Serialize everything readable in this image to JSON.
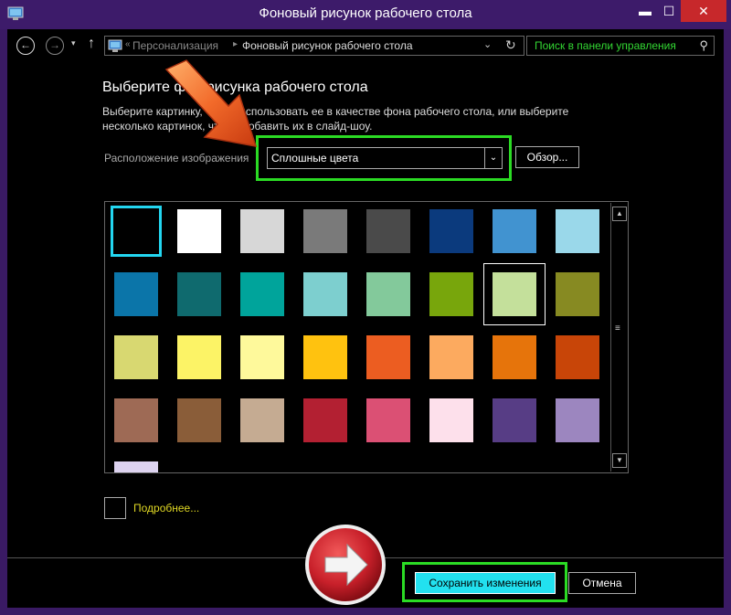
{
  "window": {
    "title": "Фоновый рисунок рабочего стола",
    "min_glyph": "▬",
    "max_glyph": "☐",
    "close_glyph": "✕"
  },
  "nav": {
    "back_glyph": "←",
    "forward_glyph": "→",
    "history_glyph": "▾",
    "up_glyph": "↑",
    "breadcrumb": [
      "Персонализация",
      "Фоновый рисунок рабочего стола"
    ],
    "crumb_lead": "«",
    "separator": "▸",
    "address_dropdown_glyph": "⌄",
    "refresh_glyph": "↻",
    "search_placeholder": "Поиск в панели управления",
    "search_glyph": "⚲"
  },
  "main": {
    "heading": "Выберите фон рисунка рабочего стола",
    "description": "Выберите картинку, чтобы использовать ее в качестве фона рабочего стола, или выберите несколько картинок, чтобы добавить их в слайд-шоу.",
    "position_label": "Расположение изображения",
    "position_value": "Сплошные цвета",
    "select_glyph": "⌄",
    "browse_label": "Обзор...",
    "more_label": "Подробнее..."
  },
  "colors": [
    "#000000",
    "#ffffff",
    "#d7d7d7",
    "#7a7a7a",
    "#4a4a4a",
    "#0b3a7d",
    "#4193d0",
    "#9ad8ea",
    "#0b75a9",
    "#0f6a6e",
    "#00a49b",
    "#7dcfcf",
    "#83c99b",
    "#78a60c",
    "#c4e09b",
    "#878a22",
    "#d8d871",
    "#fcf366",
    "#fef99b",
    "#ffc20f",
    "#ec5d21",
    "#fcaa5f",
    "#e6740b",
    "#c84508",
    "#9e6a55",
    "#8a5d39",
    "#c5ab92",
    "#b32032",
    "#db5074",
    "#fde0eb",
    "#573d85",
    "#9c86bf",
    "#ddd3f0"
  ],
  "selected_index": 0,
  "hover_index": 14,
  "scrollbar": {
    "up_glyph": "▲",
    "down_glyph": "▼",
    "grip_glyph": "≡"
  },
  "footer": {
    "save_label": "Сохранить изменения",
    "cancel_label": "Отмена"
  },
  "annotation_colors": {
    "highlight": "#2bdb24",
    "arrow": "#f05a1a",
    "next_button": "#c8202a"
  }
}
